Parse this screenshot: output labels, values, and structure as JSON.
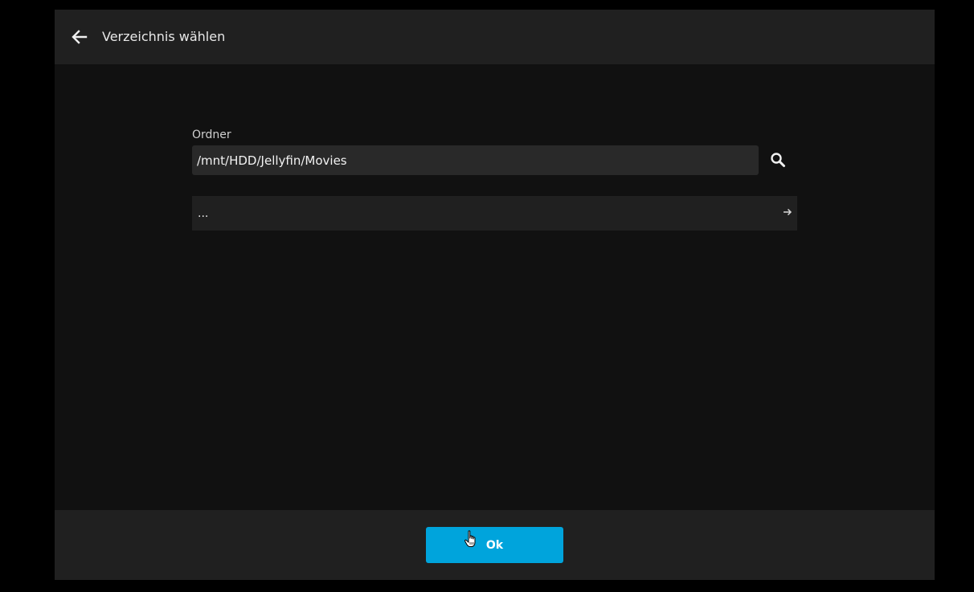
{
  "dialog": {
    "title": "Verzeichnis wählen",
    "back_icon": "arrow-left-icon"
  },
  "folder": {
    "label": "Ordner",
    "value": "/mnt/HDD/Jellyfin/Movies",
    "search_icon": "search-icon"
  },
  "directory_list": {
    "items": [
      {
        "name": "...",
        "icon": "arrow-right-icon"
      }
    ]
  },
  "footer": {
    "ok_label": "Ok"
  },
  "colors": {
    "background": "#000000",
    "dialog": "#111111",
    "header": "#202020",
    "input": "#292929",
    "accent": "#00a4dc"
  },
  "cursor_icon": "hand-pointer-icon"
}
